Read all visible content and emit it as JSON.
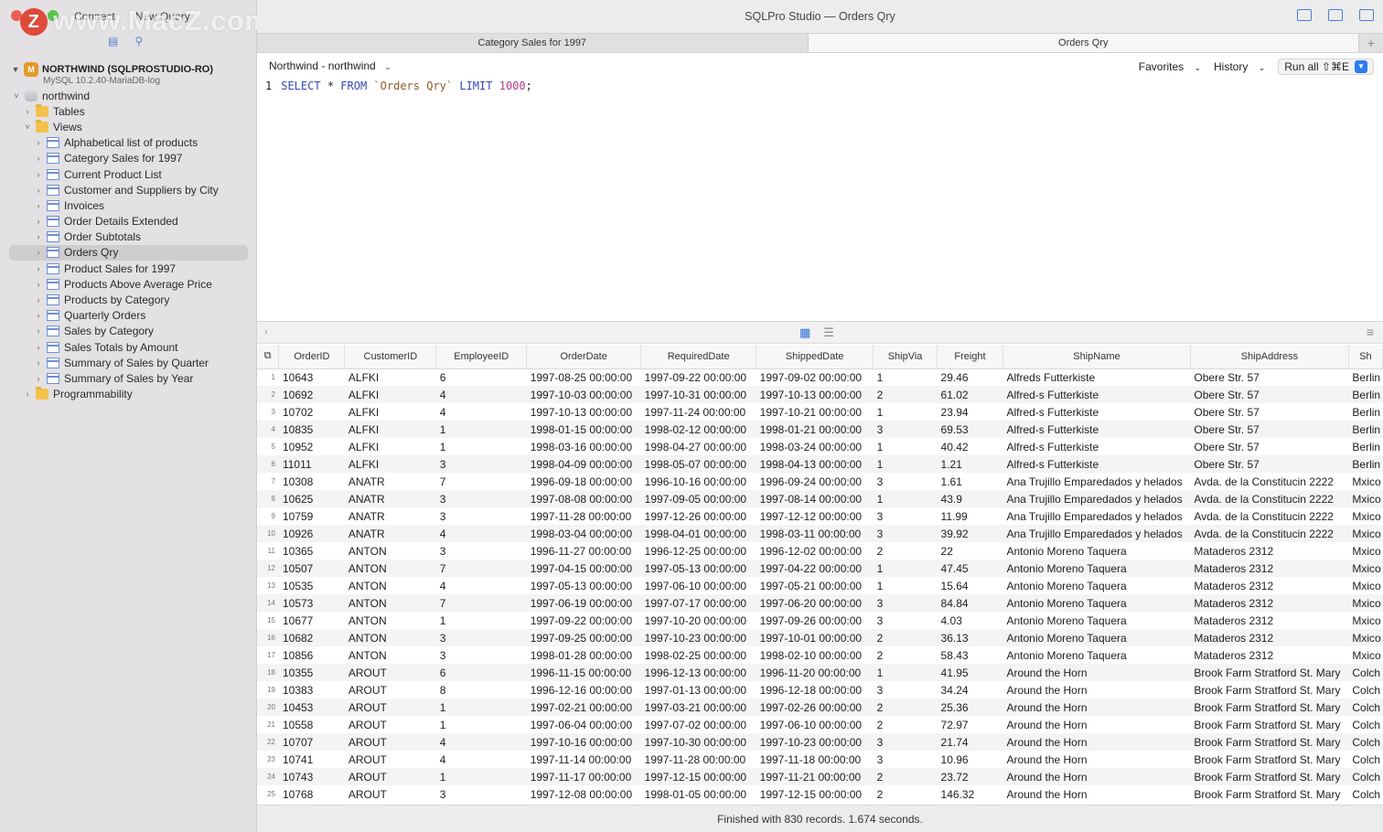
{
  "watermark": "www.MacZ.com",
  "sidebar": {
    "toolbar": [
      "Connect",
      "New Query"
    ],
    "connection": {
      "name": "NORTHWIND (SQLPROSTUDIO-RO)",
      "server": "MySQL 10.2.40-MariaDB-log"
    },
    "tree": [
      {
        "label": "northwind",
        "level": 0,
        "expanded": true,
        "type": "db"
      },
      {
        "label": "Tables",
        "level": 1,
        "expanded": false,
        "type": "folder"
      },
      {
        "label": "Views",
        "level": 1,
        "expanded": true,
        "type": "folder"
      },
      {
        "label": "Alphabetical list of products",
        "level": 2,
        "type": "view"
      },
      {
        "label": "Category Sales for 1997",
        "level": 2,
        "type": "view"
      },
      {
        "label": "Current Product List",
        "level": 2,
        "type": "view"
      },
      {
        "label": "Customer and Suppliers by City",
        "level": 2,
        "type": "view"
      },
      {
        "label": "Invoices",
        "level": 2,
        "type": "view"
      },
      {
        "label": "Order Details Extended",
        "level": 2,
        "type": "view"
      },
      {
        "label": "Order Subtotals",
        "level": 2,
        "type": "view"
      },
      {
        "label": "Orders Qry",
        "level": 2,
        "type": "view",
        "selected": true
      },
      {
        "label": "Product Sales for 1997",
        "level": 2,
        "type": "view"
      },
      {
        "label": "Products Above Average Price",
        "level": 2,
        "type": "view"
      },
      {
        "label": "Products by Category",
        "level": 2,
        "type": "view"
      },
      {
        "label": "Quarterly Orders",
        "level": 2,
        "type": "view"
      },
      {
        "label": "Sales by Category",
        "level": 2,
        "type": "view"
      },
      {
        "label": "Sales Totals by Amount",
        "level": 2,
        "type": "view"
      },
      {
        "label": "Summary of Sales by Quarter",
        "level": 2,
        "type": "view"
      },
      {
        "label": "Summary of Sales by Year",
        "level": 2,
        "type": "view"
      },
      {
        "label": "Programmability",
        "level": 1,
        "expanded": false,
        "type": "folder"
      }
    ]
  },
  "window": {
    "title": "SQLPro Studio — Orders Qry"
  },
  "tabs": [
    {
      "label": "Category Sales for 1997",
      "active": false
    },
    {
      "label": "Orders Qry",
      "active": true
    }
  ],
  "querybar": {
    "database": "Northwind - northwind",
    "favorites": "Favorites",
    "history": "History",
    "run_all": "Run all ⇧⌘E"
  },
  "editor": {
    "line_number": "1",
    "tokens": [
      {
        "t": "SELECT",
        "c": "kw"
      },
      {
        "t": " * ",
        "c": ""
      },
      {
        "t": "FROM",
        "c": "kw"
      },
      {
        "t": " ",
        "c": ""
      },
      {
        "t": "`Orders Qry`",
        "c": "str"
      },
      {
        "t": " ",
        "c": ""
      },
      {
        "t": "LIMIT",
        "c": "kw"
      },
      {
        "t": " ",
        "c": ""
      },
      {
        "t": "1000",
        "c": "num"
      },
      {
        "t": ";",
        "c": ""
      }
    ]
  },
  "results": {
    "columns": [
      "OrderID",
      "CustomerID",
      "EmployeeID",
      "OrderDate",
      "RequiredDate",
      "ShippedDate",
      "ShipVia",
      "Freight",
      "ShipName",
      "ShipAddress",
      "Sh"
    ],
    "rows": [
      [
        "10643",
        "ALFKI",
        "6",
        "1997-08-25 00:00:00",
        "1997-09-22 00:00:00",
        "1997-09-02 00:00:00",
        "1",
        "29.46",
        "Alfreds Futterkiste",
        "Obere Str. 57",
        "Berlin"
      ],
      [
        "10692",
        "ALFKI",
        "4",
        "1997-10-03 00:00:00",
        "1997-10-31 00:00:00",
        "1997-10-13 00:00:00",
        "2",
        "61.02",
        "Alfred-s Futterkiste",
        "Obere Str. 57",
        "Berlin"
      ],
      [
        "10702",
        "ALFKI",
        "4",
        "1997-10-13 00:00:00",
        "1997-11-24 00:00:00",
        "1997-10-21 00:00:00",
        "1",
        "23.94",
        "Alfred-s Futterkiste",
        "Obere Str. 57",
        "Berlin"
      ],
      [
        "10835",
        "ALFKI",
        "1",
        "1998-01-15 00:00:00",
        "1998-02-12 00:00:00",
        "1998-01-21 00:00:00",
        "3",
        "69.53",
        "Alfred-s Futterkiste",
        "Obere Str. 57",
        "Berlin"
      ],
      [
        "10952",
        "ALFKI",
        "1",
        "1998-03-16 00:00:00",
        "1998-04-27 00:00:00",
        "1998-03-24 00:00:00",
        "1",
        "40.42",
        "Alfred-s Futterkiste",
        "Obere Str. 57",
        "Berlin"
      ],
      [
        "11011",
        "ALFKI",
        "3",
        "1998-04-09 00:00:00",
        "1998-05-07 00:00:00",
        "1998-04-13 00:00:00",
        "1",
        "1.21",
        "Alfred-s Futterkiste",
        "Obere Str. 57",
        "Berlin"
      ],
      [
        "10308",
        "ANATR",
        "7",
        "1996-09-18 00:00:00",
        "1996-10-16 00:00:00",
        "1996-09-24 00:00:00",
        "3",
        "1.61",
        "Ana Trujillo Emparedados y helados",
        "Avda. de la Constitucin 2222",
        "Mxico"
      ],
      [
        "10625",
        "ANATR",
        "3",
        "1997-08-08 00:00:00",
        "1997-09-05 00:00:00",
        "1997-08-14 00:00:00",
        "1",
        "43.9",
        "Ana Trujillo Emparedados y helados",
        "Avda. de la Constitucin 2222",
        "Mxico"
      ],
      [
        "10759",
        "ANATR",
        "3",
        "1997-11-28 00:00:00",
        "1997-12-26 00:00:00",
        "1997-12-12 00:00:00",
        "3",
        "11.99",
        "Ana Trujillo Emparedados y helados",
        "Avda. de la Constitucin 2222",
        "Mxico"
      ],
      [
        "10926",
        "ANATR",
        "4",
        "1998-03-04 00:00:00",
        "1998-04-01 00:00:00",
        "1998-03-11 00:00:00",
        "3",
        "39.92",
        "Ana Trujillo Emparedados y helados",
        "Avda. de la Constitucin 2222",
        "Mxico"
      ],
      [
        "10365",
        "ANTON",
        "3",
        "1996-11-27 00:00:00",
        "1996-12-25 00:00:00",
        "1996-12-02 00:00:00",
        "2",
        "22",
        "Antonio Moreno Taquera",
        "Mataderos 2312",
        "Mxico"
      ],
      [
        "10507",
        "ANTON",
        "7",
        "1997-04-15 00:00:00",
        "1997-05-13 00:00:00",
        "1997-04-22 00:00:00",
        "1",
        "47.45",
        "Antonio Moreno Taquera",
        "Mataderos 2312",
        "Mxico"
      ],
      [
        "10535",
        "ANTON",
        "4",
        "1997-05-13 00:00:00",
        "1997-06-10 00:00:00",
        "1997-05-21 00:00:00",
        "1",
        "15.64",
        "Antonio Moreno Taquera",
        "Mataderos 2312",
        "Mxico"
      ],
      [
        "10573",
        "ANTON",
        "7",
        "1997-06-19 00:00:00",
        "1997-07-17 00:00:00",
        "1997-06-20 00:00:00",
        "3",
        "84.84",
        "Antonio Moreno Taquera",
        "Mataderos 2312",
        "Mxico"
      ],
      [
        "10677",
        "ANTON",
        "1",
        "1997-09-22 00:00:00",
        "1997-10-20 00:00:00",
        "1997-09-26 00:00:00",
        "3",
        "4.03",
        "Antonio Moreno Taquera",
        "Mataderos 2312",
        "Mxico"
      ],
      [
        "10682",
        "ANTON",
        "3",
        "1997-09-25 00:00:00",
        "1997-10-23 00:00:00",
        "1997-10-01 00:00:00",
        "2",
        "36.13",
        "Antonio Moreno Taquera",
        "Mataderos 2312",
        "Mxico"
      ],
      [
        "10856",
        "ANTON",
        "3",
        "1998-01-28 00:00:00",
        "1998-02-25 00:00:00",
        "1998-02-10 00:00:00",
        "2",
        "58.43",
        "Antonio Moreno Taquera",
        "Mataderos 2312",
        "Mxico"
      ],
      [
        "10355",
        "AROUT",
        "6",
        "1996-11-15 00:00:00",
        "1996-12-13 00:00:00",
        "1996-11-20 00:00:00",
        "1",
        "41.95",
        "Around the Horn",
        "Brook Farm Stratford St. Mary",
        "Colch"
      ],
      [
        "10383",
        "AROUT",
        "8",
        "1996-12-16 00:00:00",
        "1997-01-13 00:00:00",
        "1996-12-18 00:00:00",
        "3",
        "34.24",
        "Around the Horn",
        "Brook Farm Stratford St. Mary",
        "Colch"
      ],
      [
        "10453",
        "AROUT",
        "1",
        "1997-02-21 00:00:00",
        "1997-03-21 00:00:00",
        "1997-02-26 00:00:00",
        "2",
        "25.36",
        "Around the Horn",
        "Brook Farm Stratford St. Mary",
        "Colch"
      ],
      [
        "10558",
        "AROUT",
        "1",
        "1997-06-04 00:00:00",
        "1997-07-02 00:00:00",
        "1997-06-10 00:00:00",
        "2",
        "72.97",
        "Around the Horn",
        "Brook Farm Stratford St. Mary",
        "Colch"
      ],
      [
        "10707",
        "AROUT",
        "4",
        "1997-10-16 00:00:00",
        "1997-10-30 00:00:00",
        "1997-10-23 00:00:00",
        "3",
        "21.74",
        "Around the Horn",
        "Brook Farm Stratford St. Mary",
        "Colch"
      ],
      [
        "10741",
        "AROUT",
        "4",
        "1997-11-14 00:00:00",
        "1997-11-28 00:00:00",
        "1997-11-18 00:00:00",
        "3",
        "10.96",
        "Around the Horn",
        "Brook Farm Stratford St. Mary",
        "Colch"
      ],
      [
        "10743",
        "AROUT",
        "1",
        "1997-11-17 00:00:00",
        "1997-12-15 00:00:00",
        "1997-11-21 00:00:00",
        "2",
        "23.72",
        "Around the Horn",
        "Brook Farm Stratford St. Mary",
        "Colch"
      ],
      [
        "10768",
        "AROUT",
        "3",
        "1997-12-08 00:00:00",
        "1998-01-05 00:00:00",
        "1997-12-15 00:00:00",
        "2",
        "146.32",
        "Around the Horn",
        "Brook Farm Stratford St. Mary",
        "Colch"
      ]
    ]
  },
  "status": "Finished with 830 records. 1.674 seconds."
}
